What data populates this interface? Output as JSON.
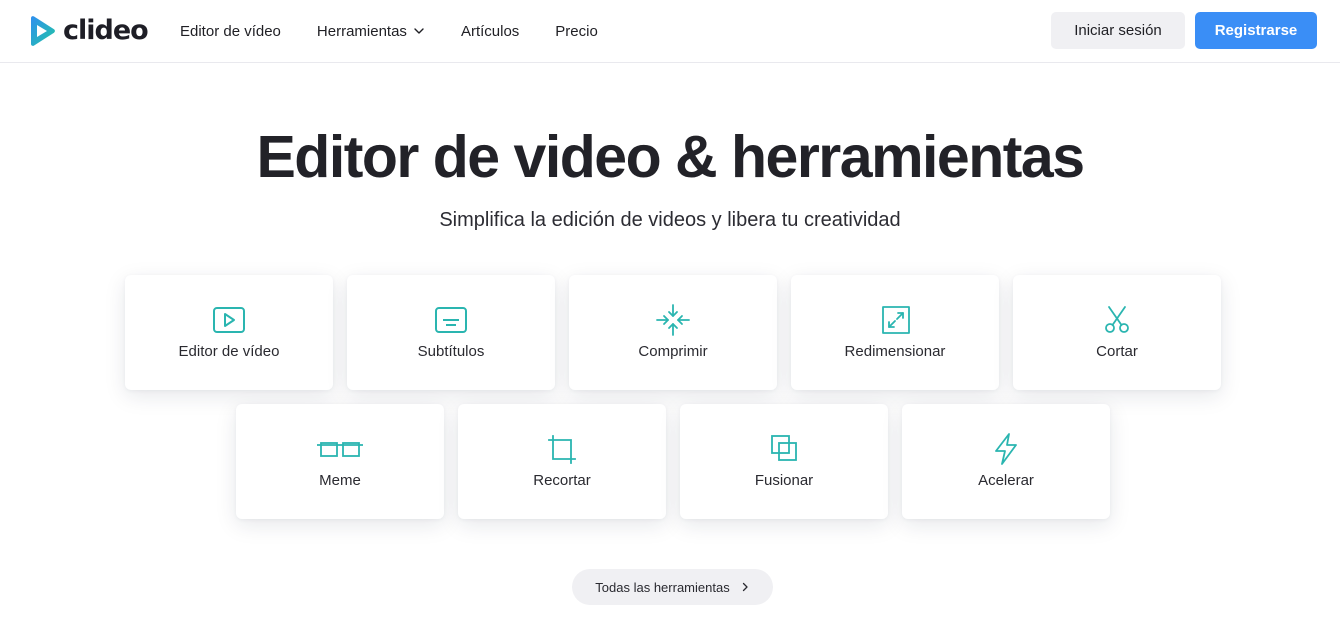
{
  "brand": {
    "name": "clideo",
    "accent": "#2ab5b0"
  },
  "nav": {
    "items": [
      {
        "label": "Editor de vídeo",
        "has_dropdown": false
      },
      {
        "label": "Herramientas",
        "has_dropdown": true
      },
      {
        "label": "Artículos",
        "has_dropdown": false
      },
      {
        "label": "Precio",
        "has_dropdown": false
      }
    ]
  },
  "auth": {
    "login_label": "Iniciar sesión",
    "register_label": "Registrarse",
    "register_color": "#3a8ef6"
  },
  "hero": {
    "title": "Editor de video & herramientas",
    "subtitle": "Simplifica la edición de videos y libera tu creatividad"
  },
  "tools": [
    {
      "label": "Editor de vídeo",
      "icon": "play-icon"
    },
    {
      "label": "Subtítulos",
      "icon": "subtitles-icon"
    },
    {
      "label": "Comprimir",
      "icon": "compress-icon"
    },
    {
      "label": "Redimensionar",
      "icon": "resize-icon"
    },
    {
      "label": "Cortar",
      "icon": "scissors-icon"
    },
    {
      "label": "Meme",
      "icon": "meme-glasses-icon"
    },
    {
      "label": "Recortar",
      "icon": "crop-icon"
    },
    {
      "label": "Fusionar",
      "icon": "merge-icon"
    },
    {
      "label": "Acelerar",
      "icon": "lightning-icon"
    }
  ],
  "all_tools": {
    "label": "Todas las herramientas",
    "icon": "chevron-right-icon"
  }
}
